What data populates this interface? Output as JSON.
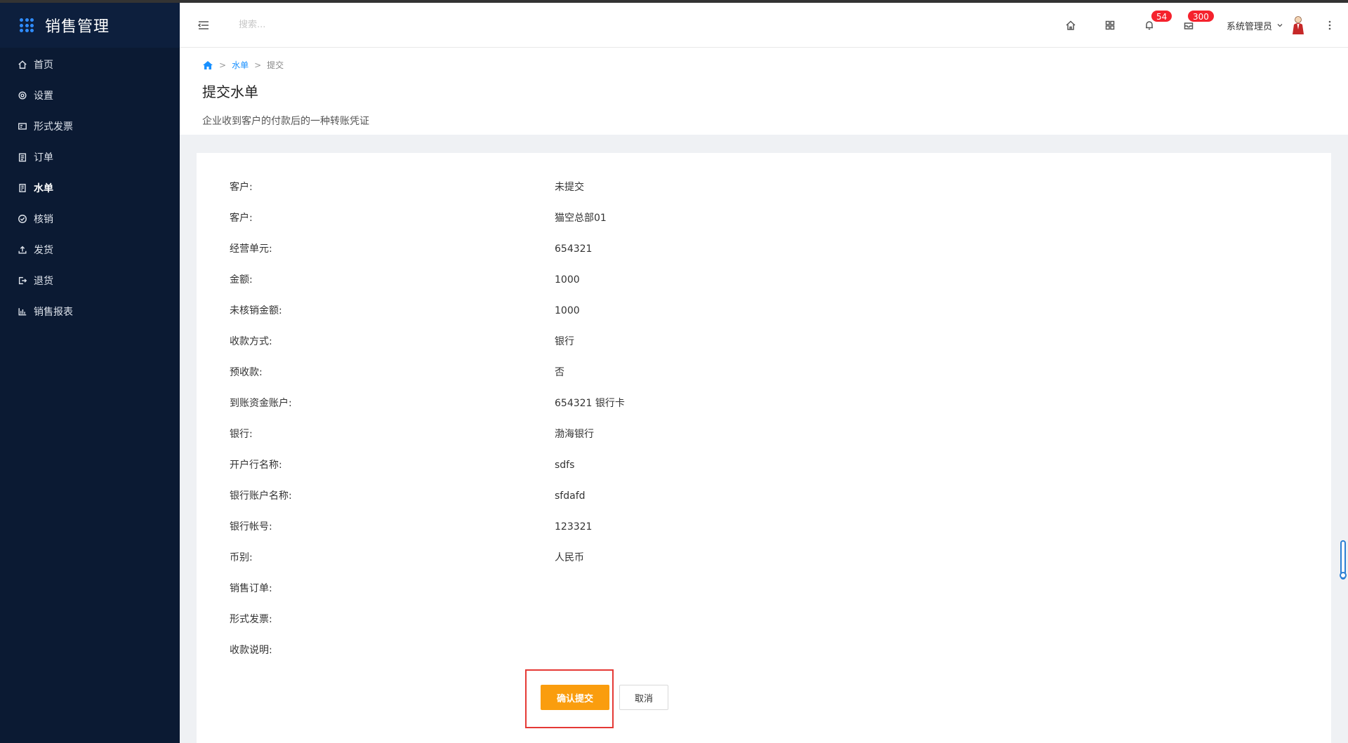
{
  "app": {
    "title": "销售管理",
    "accent": "#2f8cff",
    "sidebar_bg": "#0b1a33"
  },
  "sidebar": {
    "items": [
      {
        "label": "首页",
        "icon": "home-icon",
        "active": false
      },
      {
        "label": "设置",
        "icon": "gear-icon",
        "active": false
      },
      {
        "label": "形式发票",
        "icon": "invoice-icon",
        "active": false
      },
      {
        "label": "订单",
        "icon": "clipboard-icon",
        "active": false
      },
      {
        "label": "水单",
        "icon": "receipt-icon",
        "active": true
      },
      {
        "label": "核销",
        "icon": "check-circle-icon",
        "active": false
      },
      {
        "label": "发货",
        "icon": "upload-icon",
        "active": false
      },
      {
        "label": "退货",
        "icon": "logout-icon",
        "active": false
      },
      {
        "label": "销售报表",
        "icon": "bar-chart-icon",
        "active": false
      }
    ]
  },
  "header": {
    "search_placeholder": "搜索...",
    "notifications_count": "54",
    "messages_count": "300",
    "user_name": "系统管理员",
    "badge_color": "#f5222d"
  },
  "breadcrumb": {
    "items": [
      "水单",
      "提交"
    ]
  },
  "page": {
    "title": "提交水单",
    "description": "企业收到客户的付款后的一种转账凭证"
  },
  "form": {
    "rows": [
      {
        "label": "客户:",
        "value": "未提交"
      },
      {
        "label": "客户:",
        "value": "猫空总部01"
      },
      {
        "label": "经营单元:",
        "value": "654321"
      },
      {
        "label": "金额:",
        "value": "1000"
      },
      {
        "label": "未核销金额:",
        "value": "1000"
      },
      {
        "label": "收款方式:",
        "value": "银行"
      },
      {
        "label": "预收款:",
        "value": "否"
      },
      {
        "label": "到账资金账户:",
        "value": "654321 银行卡"
      },
      {
        "label": "银行:",
        "value": "渤海银行"
      },
      {
        "label": "开户行名称:",
        "value": "sdfs"
      },
      {
        "label": "银行账户名称:",
        "value": "sfdafd"
      },
      {
        "label": "银行帐号:",
        "value": "123321"
      },
      {
        "label": "币别:",
        "value": "人民币"
      },
      {
        "label": "销售订单:",
        "value": ""
      },
      {
        "label": "形式发票:",
        "value": ""
      },
      {
        "label": "收款说明:",
        "value": ""
      }
    ]
  },
  "actions": {
    "confirm_label": "确认提交",
    "cancel_label": "取消",
    "confirm_color": "#fa9d0e"
  }
}
